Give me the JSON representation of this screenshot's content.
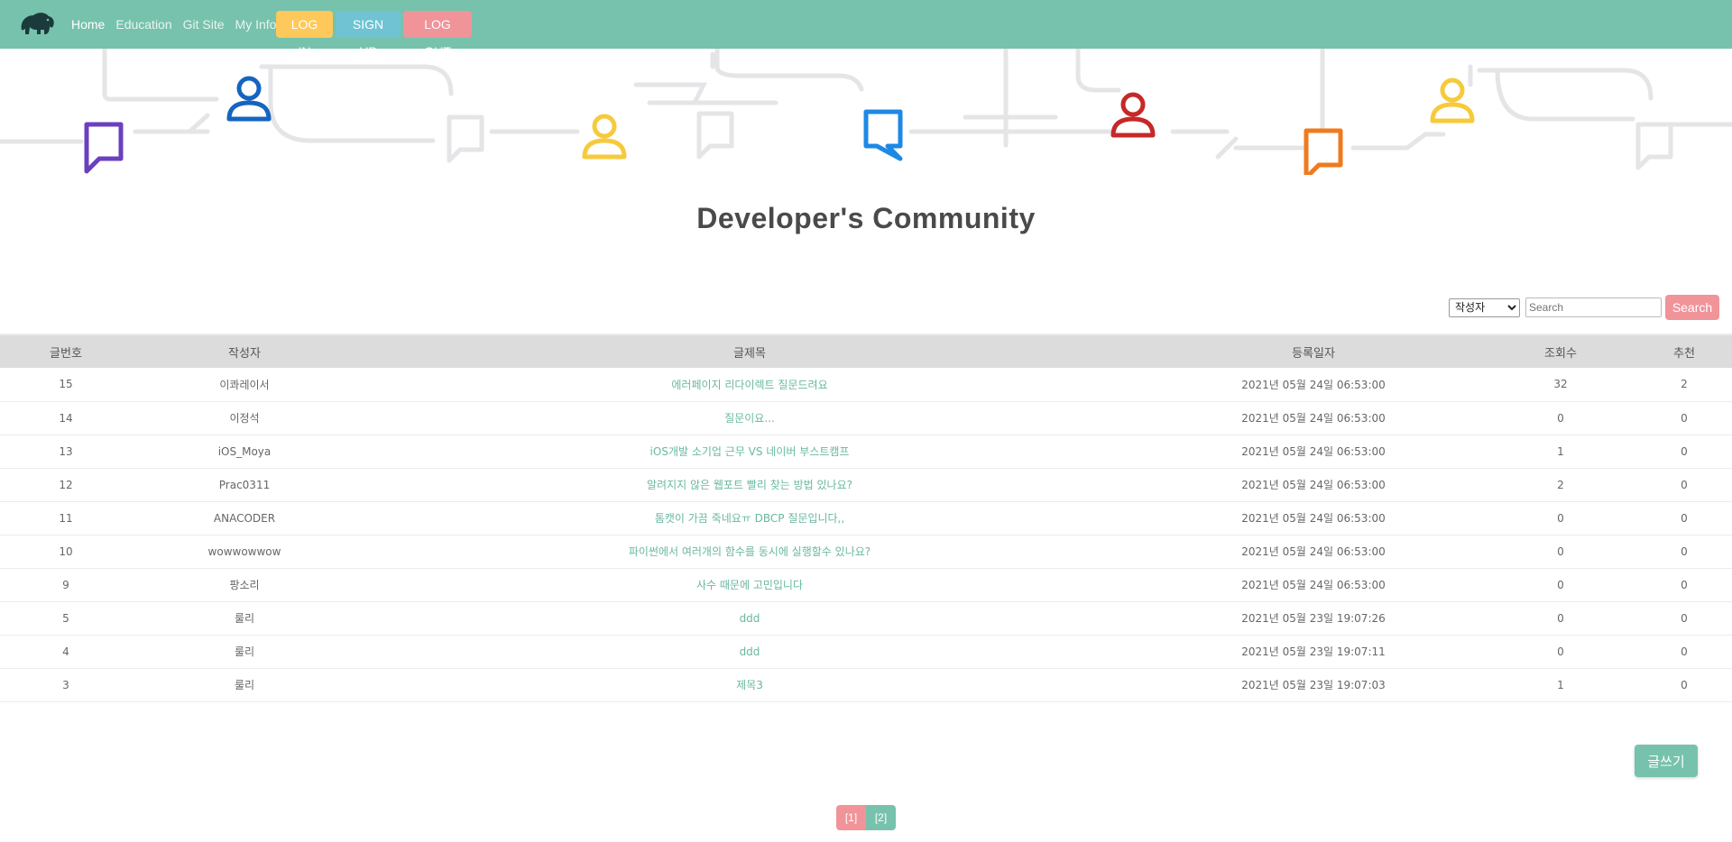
{
  "nav": {
    "links": [
      "Home",
      "Education",
      "Git Site",
      "My Info"
    ],
    "login_label": "LOG IN",
    "signup_label": "SIGN UP",
    "logout_label": "LOG OUT"
  },
  "colors": {
    "brand": "#77c2ac",
    "login": "#ffc85a",
    "signup": "#6fc3d3",
    "logout": "#f0949a"
  },
  "page_title": "Developer's Community",
  "search": {
    "selected_option": "작성자",
    "placeholder": "Search",
    "button_label": "Search"
  },
  "table": {
    "headers": [
      "글번호",
      "작성자",
      "글제목",
      "등록일자",
      "조회수",
      "추천"
    ],
    "rows": [
      [
        "15",
        "이콰레이서",
        "에러페이지 리다이렉트 질문드려요",
        "2021년 05월 24일 06:53:00",
        "32",
        "2"
      ],
      [
        "14",
        "이정석",
        "질문이요...",
        "2021년 05월 24일 06:53:00",
        "0",
        "0"
      ],
      [
        "13",
        "iOS_Moya",
        "iOS개발 소기업 근무 VS 네이버 부스트캠프",
        "2021년 05월 24일 06:53:00",
        "1",
        "0"
      ],
      [
        "12",
        "Prac0311",
        "알려지지 않은 웹포트 빨리 찾는 방법 있나요?",
        "2021년 05월 24일 06:53:00",
        "2",
        "0"
      ],
      [
        "11",
        "ANACODER",
        "톰캣이 가끔 죽네요ㅠ DBCP 질문입니다,,",
        "2021년 05월 24일 06:53:00",
        "0",
        "0"
      ],
      [
        "10",
        "wowwowwow",
        "파이썬에서 여러개의 함수를 동시에 실행할수 있나요?",
        "2021년 05월 24일 06:53:00",
        "0",
        "0"
      ],
      [
        "9",
        "팡소리",
        "사수 때문에 고민입니다",
        "2021년 05월 24일 06:53:00",
        "0",
        "0"
      ],
      [
        "5",
        "룰리",
        "ddd",
        "2021년 05월 23일 19:07:26",
        "0",
        "0"
      ],
      [
        "4",
        "룰리",
        "ddd",
        "2021년 05월 23일 19:07:11",
        "0",
        "0"
      ],
      [
        "3",
        "룰리",
        "제목3",
        "2021년 05월 23일 19:07:03",
        "1",
        "0"
      ]
    ]
  },
  "write_label": "글쓰기",
  "pagination": [
    "[1]",
    "[2]"
  ]
}
